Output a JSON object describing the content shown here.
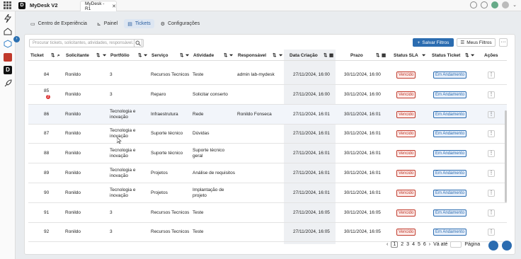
{
  "app": {
    "title": "MyDesk V2",
    "tab": "MyDesk - R1",
    "logo_letter": "D"
  },
  "subnav": [
    {
      "label": "Centro de Experiência",
      "icon": "monitor-icon"
    },
    {
      "label": "Painel",
      "icon": "chart-icon"
    },
    {
      "label": "Tickets",
      "icon": "ticket-icon",
      "active": true
    },
    {
      "label": "Configurações",
      "icon": "gear-icon"
    }
  ],
  "toolbar": {
    "search_placeholder": "Procurar tickets, solicitantes, atividades, responsável...",
    "save_filters": "Salvar Filtros",
    "my_filters": "Meus Filtros",
    "more": "···"
  },
  "columns": [
    "Ticket",
    "Solicitante",
    "Portfólio",
    "Serviço",
    "Atividade",
    "Responsável",
    "Data Criação",
    "Prazo",
    "Status SLA",
    "Status Ticket",
    "Ações"
  ],
  "rows": [
    {
      "ticket": "84",
      "solicitante": "Ronildo",
      "portfolio": "3",
      "servico": "Recursos Tecnicos",
      "atividade": "Teste",
      "responsavel": "admin lab-mydesk",
      "data": "27/11/2024, 16:00",
      "prazo": "30/11/2024, 16:00",
      "sla": "Vencido",
      "status": "Em Andamento"
    },
    {
      "ticket": "85",
      "badge": "2",
      "solicitante": "Ronildo",
      "portfolio": "3",
      "servico": "Reparo",
      "atividade": "Solicitar conserto",
      "responsavel": "",
      "data": "27/11/2024, 16:00",
      "prazo": "30/11/2024, 16:00",
      "sla": "Vencido",
      "status": "Em Andamento"
    },
    {
      "ticket": "86",
      "solicitante": "Ronildo",
      "portfolio": "Tecnologia e inovação",
      "servico": "Infraestrutura",
      "atividade": "Rede",
      "responsavel": "Ronildo Fonseca",
      "data": "27/11/2024, 16:01",
      "prazo": "30/11/2024, 16:01",
      "sla": "Vencido",
      "status": "Em Andamento"
    },
    {
      "ticket": "87",
      "solicitante": "Ronildo",
      "portfolio": "Tecnologia e inovação",
      "servico": "Suporte técnico",
      "atividade": "Dúvidas",
      "responsavel": "",
      "data": "27/11/2024, 16:01",
      "prazo": "30/11/2024, 16:01",
      "sla": "Vencido",
      "status": "Em Andamento"
    },
    {
      "ticket": "88",
      "solicitante": "Ronildo",
      "portfolio": "Tecnologia e inovação",
      "servico": "Suporte técnico",
      "atividade": "Suporte técnico geral",
      "responsavel": "",
      "data": "27/11/2024, 16:01",
      "prazo": "30/11/2024, 16:01",
      "sla": "Vencido",
      "status": "Em Andamento"
    },
    {
      "ticket": "89",
      "solicitante": "Ronildo",
      "portfolio": "Tecnologia e inovação",
      "servico": "Projetos",
      "atividade": "Análise de requisitos",
      "responsavel": "",
      "data": "27/11/2024, 16:01",
      "prazo": "30/11/2024, 16:01",
      "sla": "Vencido",
      "status": "Em Andamento"
    },
    {
      "ticket": "90",
      "solicitante": "Ronildo",
      "portfolio": "Tecnologia e inovação",
      "servico": "Projetos",
      "atividade": "Implantação de projeto",
      "responsavel": "",
      "data": "27/11/2024, 16:01",
      "prazo": "30/11/2024, 16:01",
      "sla": "Vencido",
      "status": "Em Andamento"
    },
    {
      "ticket": "91",
      "solicitante": "Ronildo",
      "portfolio": "3",
      "servico": "Recursos Tecnicos",
      "atividade": "Teste",
      "responsavel": "",
      "data": "27/11/2024, 16:05",
      "prazo": "30/11/2024, 16:05",
      "sla": "Vencido",
      "status": "Em Andamento"
    },
    {
      "ticket": "92",
      "solicitante": "Ronildo",
      "portfolio": "3",
      "servico": "Recursos Tecnicos",
      "atividade": "Teste",
      "responsavel": "",
      "data": "27/11/2024, 16:05",
      "prazo": "30/11/2024, 16:05",
      "sla": "Vencido",
      "status": "Em Andamento"
    }
  ],
  "row_action": "⋮",
  "pagination": {
    "prev": "‹",
    "pages": [
      "1",
      "2",
      "3",
      "4",
      "5",
      "6"
    ],
    "next": "›",
    "goto_label": "Vá até",
    "page_label": "Página"
  }
}
